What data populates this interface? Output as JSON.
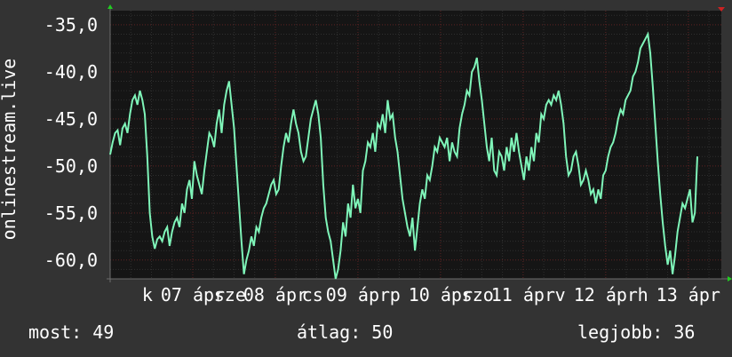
{
  "chart_data": {
    "type": "line",
    "ylabel": "onlinestream.live",
    "ylim": [
      -62,
      -33.5
    ],
    "yticks": [
      "-35,0",
      "-40,0",
      "-45,0",
      "-50,0",
      "-55,0",
      "-60,0"
    ],
    "ytick_values": [
      -35,
      -40,
      -45,
      -50,
      -55,
      -60
    ],
    "xticks": [
      {
        "label": "k",
        "x": 0.45
      },
      {
        "label": "07 ápr",
        "x": 1.0
      },
      {
        "label": "sze",
        "x": 1.45
      },
      {
        "label": "08 ápr",
        "x": 2.0
      },
      {
        "label": "cs",
        "x": 2.45
      },
      {
        "label": "09 ápr",
        "x": 3.0
      },
      {
        "label": "p",
        "x": 3.45
      },
      {
        "label": "10 ápr",
        "x": 4.0
      },
      {
        "label": "szo",
        "x": 4.45
      },
      {
        "label": "11 ápr",
        "x": 5.0
      },
      {
        "label": "v",
        "x": 5.45
      },
      {
        "label": "12 ápr",
        "x": 6.0
      },
      {
        "label": "h",
        "x": 6.45
      },
      {
        "label": "13 ápr",
        "x": 7.0
      }
    ],
    "xlim": [
      0,
      7.4
    ],
    "grid": true,
    "colors": {
      "line": "#7ff5b9",
      "background": "#151515",
      "grid_minor": "#2f2f2f",
      "grid_major": "#5a1f1f",
      "axis": "#6c6c6c",
      "arrow": "#22cc22"
    },
    "x": [
      0.0,
      0.03,
      0.06,
      0.09,
      0.12,
      0.15,
      0.18,
      0.21,
      0.24,
      0.27,
      0.3,
      0.33,
      0.36,
      0.39,
      0.42,
      0.45,
      0.48,
      0.51,
      0.54,
      0.57,
      0.6,
      0.63,
      0.66,
      0.69,
      0.72,
      0.75,
      0.78,
      0.81,
      0.84,
      0.87,
      0.9,
      0.93,
      0.96,
      0.99,
      1.02,
      1.05,
      1.08,
      1.11,
      1.14,
      1.17,
      1.2,
      1.23,
      1.26,
      1.29,
      1.32,
      1.35,
      1.38,
      1.41,
      1.44,
      1.47,
      1.5,
      1.53,
      1.56,
      1.59,
      1.62,
      1.65,
      1.68,
      1.71,
      1.74,
      1.77,
      1.8,
      1.83,
      1.86,
      1.89,
      1.92,
      1.95,
      1.98,
      2.01,
      2.04,
      2.07,
      2.1,
      2.13,
      2.16,
      2.19,
      2.22,
      2.25,
      2.28,
      2.31,
      2.34,
      2.37,
      2.4,
      2.43,
      2.46,
      2.49,
      2.52,
      2.55,
      2.58,
      2.61,
      2.64,
      2.67,
      2.7,
      2.73,
      2.76,
      2.79,
      2.82,
      2.85,
      2.88,
      2.91,
      2.94,
      2.97,
      3.0,
      3.03,
      3.06,
      3.09,
      3.12,
      3.15,
      3.18,
      3.21,
      3.24,
      3.27,
      3.3,
      3.33,
      3.36,
      3.39,
      3.42,
      3.45,
      3.48,
      3.51,
      3.54,
      3.57,
      3.6,
      3.63,
      3.66,
      3.69,
      3.72,
      3.75,
      3.78,
      3.81,
      3.84,
      3.87,
      3.9,
      3.93,
      3.96,
      3.99,
      4.02,
      4.05,
      4.08,
      4.11,
      4.14,
      4.17,
      4.2,
      4.23,
      4.26,
      4.29,
      4.32,
      4.35,
      4.38,
      4.41,
      4.44,
      4.47,
      4.5,
      4.53,
      4.56,
      4.59,
      4.62,
      4.65,
      4.68,
      4.71,
      4.74,
      4.77,
      4.8,
      4.83,
      4.86,
      4.89,
      4.92,
      4.95,
      4.98,
      5.01,
      5.04,
      5.07,
      5.1,
      5.13,
      5.16,
      5.19,
      5.22,
      5.25,
      5.28,
      5.31,
      5.34,
      5.37,
      5.4,
      5.43,
      5.46,
      5.49,
      5.52,
      5.55,
      5.58,
      5.61,
      5.64,
      5.67,
      5.7,
      5.73,
      5.76,
      5.79,
      5.82,
      5.85,
      5.88,
      5.91,
      5.94,
      5.97,
      6.0,
      6.03,
      6.06,
      6.09,
      6.12,
      6.15,
      6.18,
      6.21,
      6.24,
      6.27,
      6.3,
      6.33,
      6.36,
      6.39,
      6.42,
      6.45,
      6.48,
      6.51,
      6.54,
      6.57,
      6.6,
      6.63,
      6.66,
      6.69,
      6.72,
      6.75,
      6.78,
      6.81,
      6.84,
      6.87,
      6.9,
      6.93,
      6.96,
      6.99,
      7.02,
      7.05,
      7.08,
      7.11,
      7.14,
      7.17,
      7.2,
      7.23,
      7.26,
      7.29,
      7.32,
      7.35,
      7.38,
      7.4
    ],
    "values": [
      -48.8,
      -47.5,
      -46.5,
      -46.2,
      -47.8,
      -46.0,
      -45.5,
      -46.5,
      -44.5,
      -43.0,
      -42.5,
      -43.5,
      -42.0,
      -43.0,
      -44.5,
      -49.0,
      -55.0,
      -57.5,
      -58.8,
      -57.8,
      -57.5,
      -58.0,
      -57.0,
      -56.5,
      -58.5,
      -57.0,
      -56.0,
      -55.5,
      -56.5,
      -54.0,
      -55.0,
      -52.5,
      -51.5,
      -53.5,
      -49.5,
      -51.0,
      -52.0,
      -53.0,
      -50.5,
      -48.5,
      -46.5,
      -47.0,
      -48.0,
      -45.5,
      -44.0,
      -46.5,
      -43.5,
      -42.0,
      -41.0,
      -43.5,
      -46.0,
      -50.0,
      -54.0,
      -58.0,
      -61.5,
      -60.0,
      -59.0,
      -57.5,
      -58.5,
      -56.5,
      -57.0,
      -55.5,
      -54.5,
      -54.0,
      -53.0,
      -52.0,
      -51.5,
      -53.0,
      -52.5,
      -50.0,
      -48.0,
      -46.5,
      -47.5,
      -45.5,
      -44.0,
      -45.5,
      -46.5,
      -48.5,
      -49.5,
      -49.0,
      -47.0,
      -45.0,
      -44.0,
      -43.0,
      -44.5,
      -47.0,
      -52.0,
      -55.5,
      -57.0,
      -58.0,
      -60.0,
      -62.0,
      -61.0,
      -59.0,
      -56.0,
      -57.5,
      -54.0,
      -55.5,
      -52.0,
      -54.5,
      -53.5,
      -55.0,
      -50.5,
      -49.5,
      -47.5,
      -48.0,
      -46.5,
      -48.5,
      -45.5,
      -46.0,
      -44.5,
      -46.5,
      -43.0,
      -45.0,
      -44.5,
      -47.0,
      -48.5,
      -51.0,
      -53.5,
      -55.0,
      -56.5,
      -57.5,
      -55.5,
      -59.0,
      -56.5,
      -54.0,
      -52.5,
      -53.5,
      -51.0,
      -51.5,
      -50.0,
      -48.0,
      -48.5,
      -47.0,
      -47.5,
      -48.0,
      -47.0,
      -49.5,
      -47.5,
      -48.5,
      -49.0,
      -46.0,
      -44.5,
      -43.5,
      -42.0,
      -42.5,
      -40.0,
      -39.5,
      -38.5,
      -41.0,
      -43.0,
      -45.5,
      -48.0,
      -49.5,
      -47.0,
      -50.5,
      -51.0,
      -48.5,
      -49.0,
      -50.5,
      -48.0,
      -49.5,
      -47.0,
      -48.5,
      -46.5,
      -48.5,
      -50.0,
      -51.5,
      -49.0,
      -50.5,
      -48.0,
      -49.5,
      -46.5,
      -47.5,
      -44.5,
      -45.0,
      -43.5,
      -43.0,
      -43.5,
      -42.5,
      -43.0,
      -42.0,
      -43.5,
      -45.5,
      -49.0,
      -51.0,
      -50.5,
      -49.0,
      -48.5,
      -50.0,
      -52.0,
      -51.5,
      -50.5,
      -51.5,
      -53.0,
      -52.5,
      -54.0,
      -52.5,
      -53.5,
      -51.0,
      -50.5,
      -49.0,
      -48.0,
      -47.5,
      -46.5,
      -45.0,
      -44.0,
      -44.5,
      -43.0,
      -42.5,
      -42.0,
      -40.5,
      -40.0,
      -39.0,
      -37.5,
      -37.0,
      -36.5,
      -36.0,
      -38.0,
      -41.5,
      -45.5,
      -49.5,
      -53.0,
      -56.0,
      -58.5,
      -60.5,
      -59.0,
      -61.5,
      -59.5,
      -57.0,
      -55.5,
      -54.0,
      -54.5,
      -53.5,
      -52.5,
      -56.0,
      -55.0,
      -49.0
    ],
    "legend": []
  },
  "footer": {
    "now": "most: 49",
    "avg": "átlag: 50",
    "best": "legjobb: 36"
  }
}
